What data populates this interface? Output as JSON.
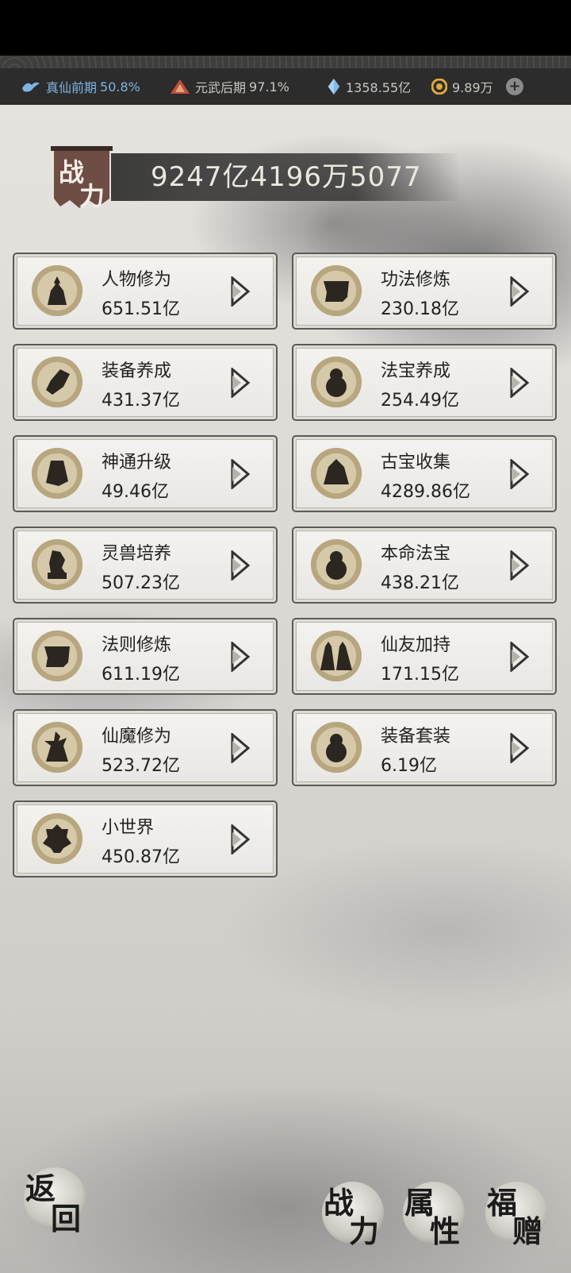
{
  "status": {
    "realm1": {
      "label": "真仙前期",
      "pct": "50.8%"
    },
    "realm2": {
      "label": "元武后期",
      "pct": "97.1%"
    },
    "crystal": "1358.55亿",
    "coin": "9.89万"
  },
  "power": {
    "tag": [
      "战",
      "力"
    ],
    "value": "9247亿4196万5077"
  },
  "cards": [
    {
      "name": "人物修为",
      "value": "651.51亿"
    },
    {
      "name": "功法修炼",
      "value": "230.18亿"
    },
    {
      "name": "装备养成",
      "value": "431.37亿"
    },
    {
      "name": "法宝养成",
      "value": "254.49亿"
    },
    {
      "name": "神通升级",
      "value": "49.46亿"
    },
    {
      "name": "古宝收集",
      "value": "4289.86亿"
    },
    {
      "name": "灵兽培养",
      "value": "507.23亿"
    },
    {
      "name": "本命法宝",
      "value": "438.21亿"
    },
    {
      "name": "法则修炼",
      "value": "611.19亿"
    },
    {
      "name": "仙友加持",
      "value": "171.15亿"
    },
    {
      "name": "仙魔修为",
      "value": "523.72亿"
    },
    {
      "name": "装备套装",
      "value": "6.19亿"
    },
    {
      "name": "小世界",
      "value": "450.87亿"
    }
  ],
  "bottom": {
    "back": [
      "返",
      "回"
    ],
    "tab_power": [
      "战",
      "力"
    ],
    "tab_attr": [
      "属",
      "性"
    ],
    "tab_gift": [
      "福",
      "赠"
    ]
  },
  "colors": {
    "realm1": "#7fb3e0",
    "panel": "#2c2c2c"
  }
}
